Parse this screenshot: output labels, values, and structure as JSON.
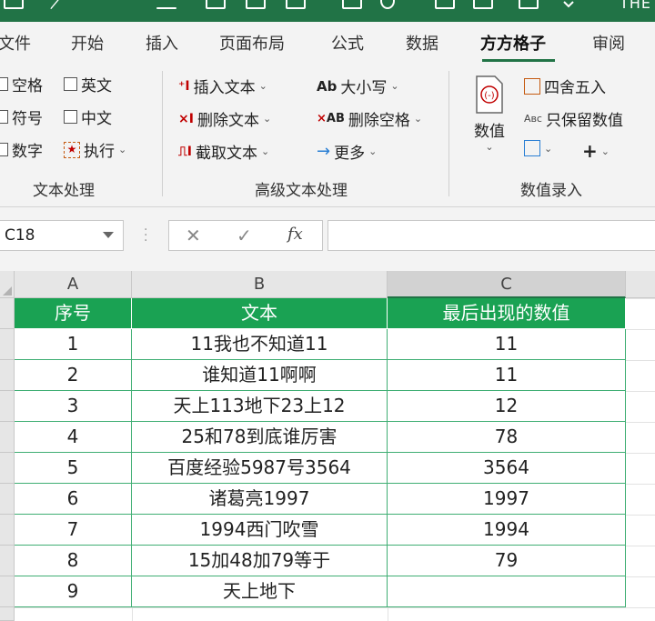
{
  "title_bar": {
    "text": "THE"
  },
  "tabs": [
    {
      "label": "文件"
    },
    {
      "label": "开始"
    },
    {
      "label": "插入"
    },
    {
      "label": "页面布局"
    },
    {
      "label": "公式"
    },
    {
      "label": "数据"
    },
    {
      "label": "方方格子"
    },
    {
      "label": "审阅"
    }
  ],
  "active_tab": "方方格子",
  "ribbon": {
    "text_process": {
      "items": [
        "空格",
        "英文",
        "符号",
        "中文",
        "数字"
      ],
      "execute": "执行",
      "label": "文本处理"
    },
    "advanced": {
      "items": [
        "插入文本",
        "删除文本",
        "截取文本",
        "大小写",
        "删除空格",
        "更多"
      ],
      "label": "高级文本处理"
    },
    "numeric": {
      "value_button": "数值",
      "round": "四舍五入",
      "keep_numeric": "只保留数值",
      "label": "数值录入"
    }
  },
  "formula_bar": {
    "name_box": "C18",
    "formula": ""
  },
  "columns": [
    "A",
    "B",
    "C"
  ],
  "table": {
    "headers": [
      "序号",
      "文本",
      "最后出现的数值"
    ],
    "rows": [
      [
        "1",
        "11我也不知道11",
        "11"
      ],
      [
        "2",
        "谁知道11啊啊",
        "11"
      ],
      [
        "3",
        "天上113地下23上12",
        "12"
      ],
      [
        "4",
        "25和78到底谁厉害",
        "78"
      ],
      [
        "5",
        "百度经验5987号3564",
        "3564"
      ],
      [
        "6",
        "诸葛亮1997",
        "1997"
      ],
      [
        "7",
        "1994西门吹雪",
        "1994"
      ],
      [
        "8",
        "15加48加79等于",
        "79"
      ],
      [
        "9",
        "天上地下",
        ""
      ]
    ]
  },
  "colors": {
    "accent": "#217346",
    "table_header": "#1aa253",
    "table_border": "#3fae73"
  }
}
